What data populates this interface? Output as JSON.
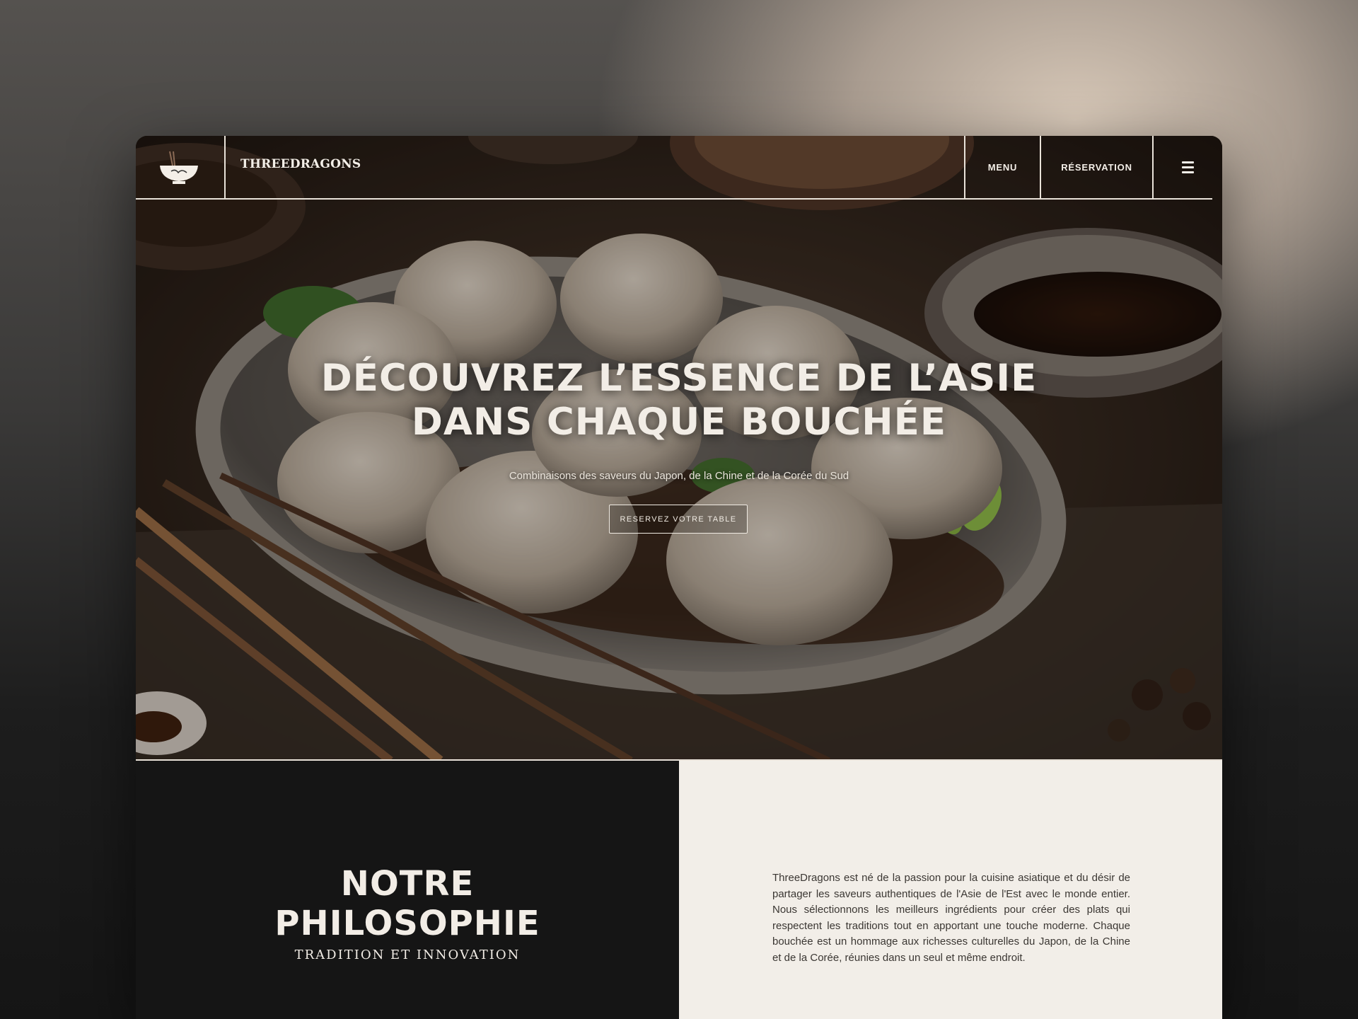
{
  "header": {
    "brand": "THREEDRAGONS",
    "logo": "noodle-bowl-logo",
    "nav": {
      "menu_label": "MENU",
      "reservation_label": "RÉSERVATION",
      "hamburger_icon": "hamburger-icon"
    }
  },
  "hero": {
    "title_line1": "DÉCOUVREZ L’ESSENCE DE L’ASIE",
    "title_line2": "DANS CHAQUE BOUCHÉE",
    "subtitle": "Combinaisons des saveurs du Japon, de la Chine et de la Corée du Sud",
    "cta_label": "RESERVEZ VOTRE TABLE",
    "background": "dumplings-photo"
  },
  "philosophy": {
    "title_line1": "NOTRE",
    "title_line2": "PHILOSOPHIE",
    "subtitle": "TRADITION ET INNOVATION",
    "body": "ThreeDragons est né de la passion pour la cuisine asiatique et du désir de partager les saveurs authentiques de l'Asie de l'Est avec le monde entier. Nous sélectionnons les meilleurs ingrédients pour créer des plats qui respectent les traditions tout en apportant une touche moderne. Chaque bouchée est un hommage aux richesses culturelles du Japon, de la Chine et de la Corée, réunies dans un seul et même endroit."
  },
  "colors": {
    "dark": "#151515",
    "cream": "#f2eee8",
    "text_light": "#f2ede6"
  }
}
